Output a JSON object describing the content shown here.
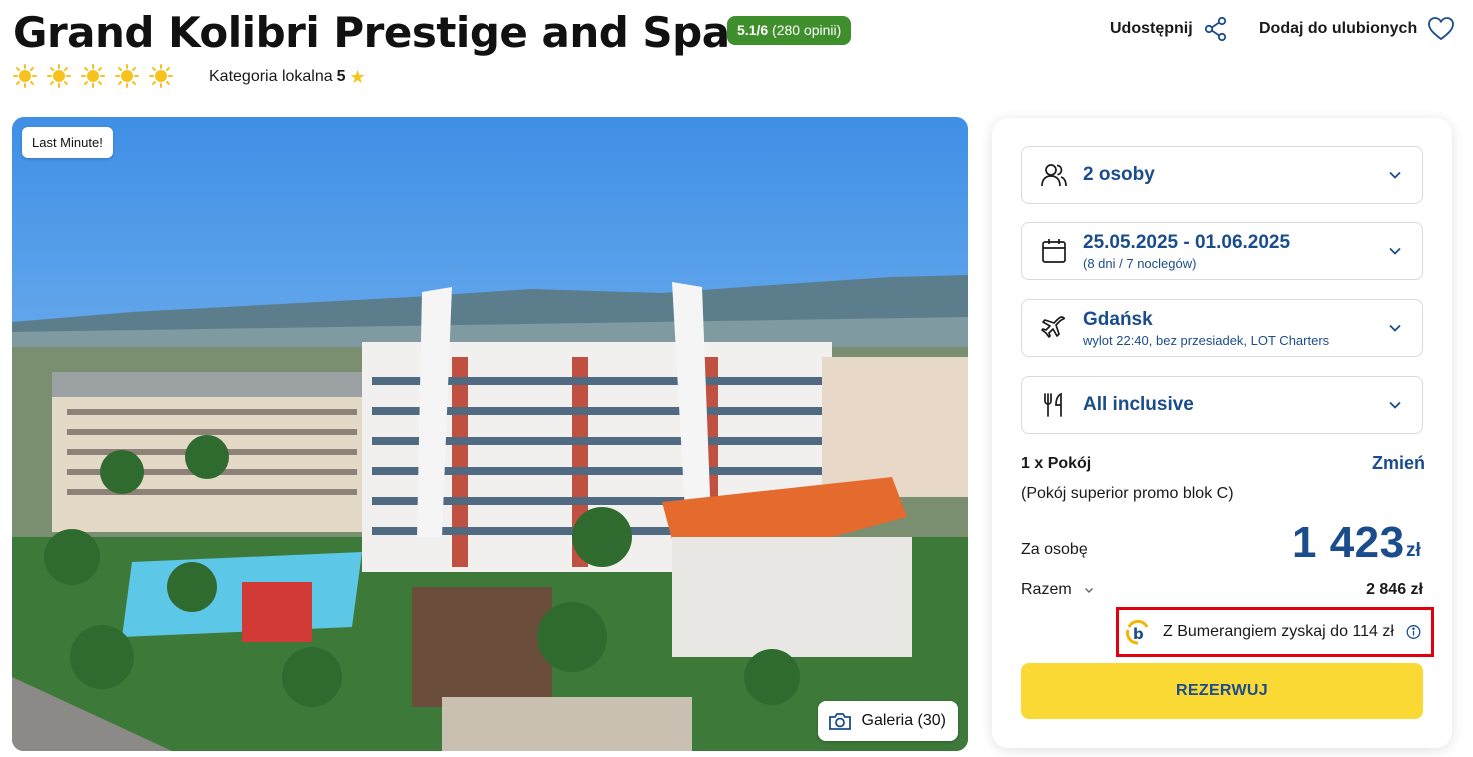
{
  "hotel": {
    "title": "Grand Kolibri Prestige and Spa",
    "rating_score": "5.1/6",
    "rating_count": "(280 opinii)",
    "sun_rating": 5,
    "local_category_label": "Kategoria lokalna",
    "local_category_value": "5"
  },
  "actions": {
    "share_label": "Udostępnij",
    "favorite_label": "Dodaj do ulubionych"
  },
  "gallery": {
    "badge": "Last Minute!",
    "button_label": "Galeria (30)"
  },
  "booking": {
    "persons": {
      "label": "2 osoby",
      "icon": "people-icon"
    },
    "dates": {
      "label": "25.05.2025 - 01.06.2025",
      "sub": "(8 dni / 7 noclegów)",
      "icon": "calendar-icon"
    },
    "departure": {
      "label": "Gdańsk",
      "sub": "wylot 22:40, bez przesiadek, LOT Charters",
      "icon": "plane-icon"
    },
    "board": {
      "label": "All inclusive",
      "icon": "cutlery-icon"
    },
    "room_count": "1 x Pokój",
    "room_change": "Zmień",
    "room_desc": "(Pokój superior promo blok C)",
    "per_person_label": "Za osobę",
    "per_person_value": "1 423",
    "currency": "zł",
    "total_label": "Razem",
    "total_value": "2 846 zł",
    "bumerang_text": "Z Bumerangiem zyskaj do 114 zł",
    "reserve_label": "REZERWUJ"
  },
  "colors": {
    "brand_blue": "#1b4d8c",
    "rating_green": "#3f8f2c",
    "reserve_yellow": "#fad934",
    "highlight_red": "#e3000f",
    "sun_yellow": "#f7c21e"
  }
}
